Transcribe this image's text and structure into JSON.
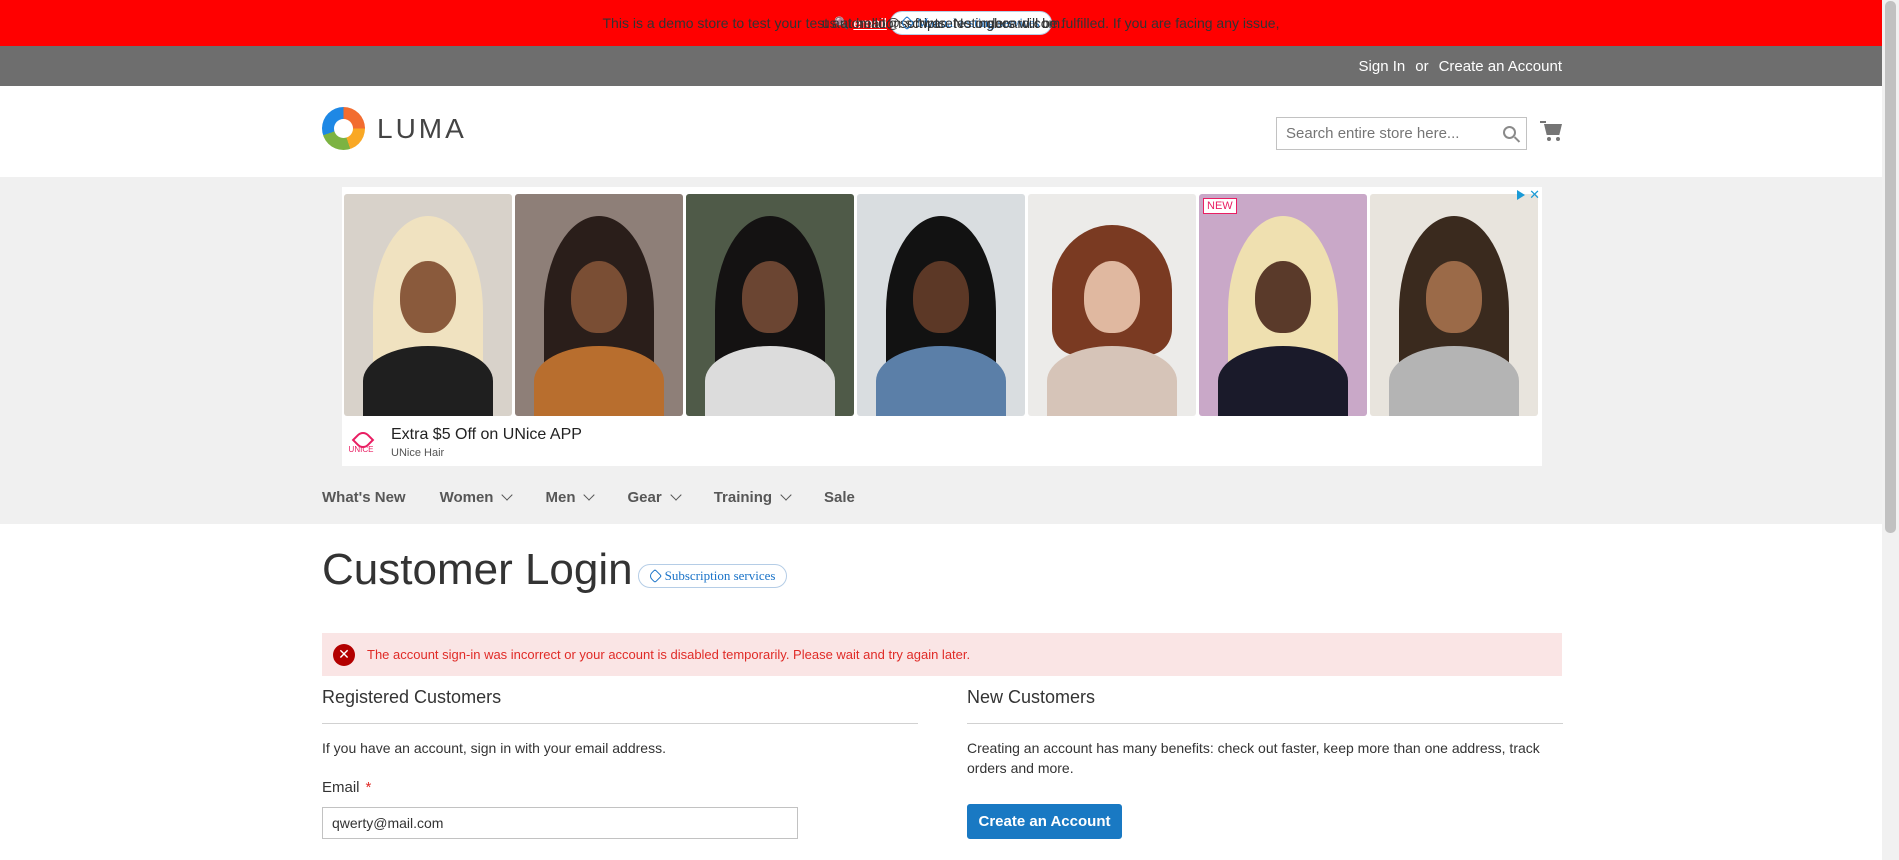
{
  "demo_banner": {
    "text": "This is a demo store to test your test automaiton scripts. No orders will be fulfilled. If you are facing any issue,",
    "email_link": "email",
    "suffix": "us at hello@softwaretestingboard.com.",
    "pill_label": "Manual testing services"
  },
  "header": {
    "sign_in": "Sign In",
    "or": "or",
    "create_account": "Create an Account"
  },
  "logo": {
    "text": "LUMA"
  },
  "search": {
    "placeholder": "Search entire store here..."
  },
  "ad": {
    "badge": "NEW",
    "headline": "Extra $5 Off on UNice APP",
    "advertiser": "UNice Hair",
    "brand": "UNICE",
    "close": "✕"
  },
  "nav": {
    "items": [
      {
        "label": "What's New",
        "has_dropdown": false
      },
      {
        "label": "Women",
        "has_dropdown": true
      },
      {
        "label": "Men",
        "has_dropdown": true
      },
      {
        "label": "Gear",
        "has_dropdown": true
      },
      {
        "label": "Training",
        "has_dropdown": true
      },
      {
        "label": "Sale",
        "has_dropdown": false
      }
    ]
  },
  "main": {
    "title": "Customer Login",
    "title_pill": "Subscription services",
    "error": "The account sign-in was incorrect or your account is disabled temporarily. Please wait and try again later.",
    "registered": {
      "title": "Registered Customers",
      "intro": "If you have an account, sign in with your email address.",
      "email_label": "Email",
      "required_mark": "*",
      "email_value": "qwerty@mail.com"
    },
    "new_customers": {
      "title": "New Customers",
      "text": "Creating an account has many benefits: check out faster, keep more than one address, track orders and more.",
      "button": "Create an Account"
    }
  },
  "colors": {
    "banner": "#ff0000",
    "header_bar": "#6e6e6e",
    "primary_button": "#1979c3",
    "error_bg": "#fae5e5",
    "error_text": "#e02b27"
  }
}
